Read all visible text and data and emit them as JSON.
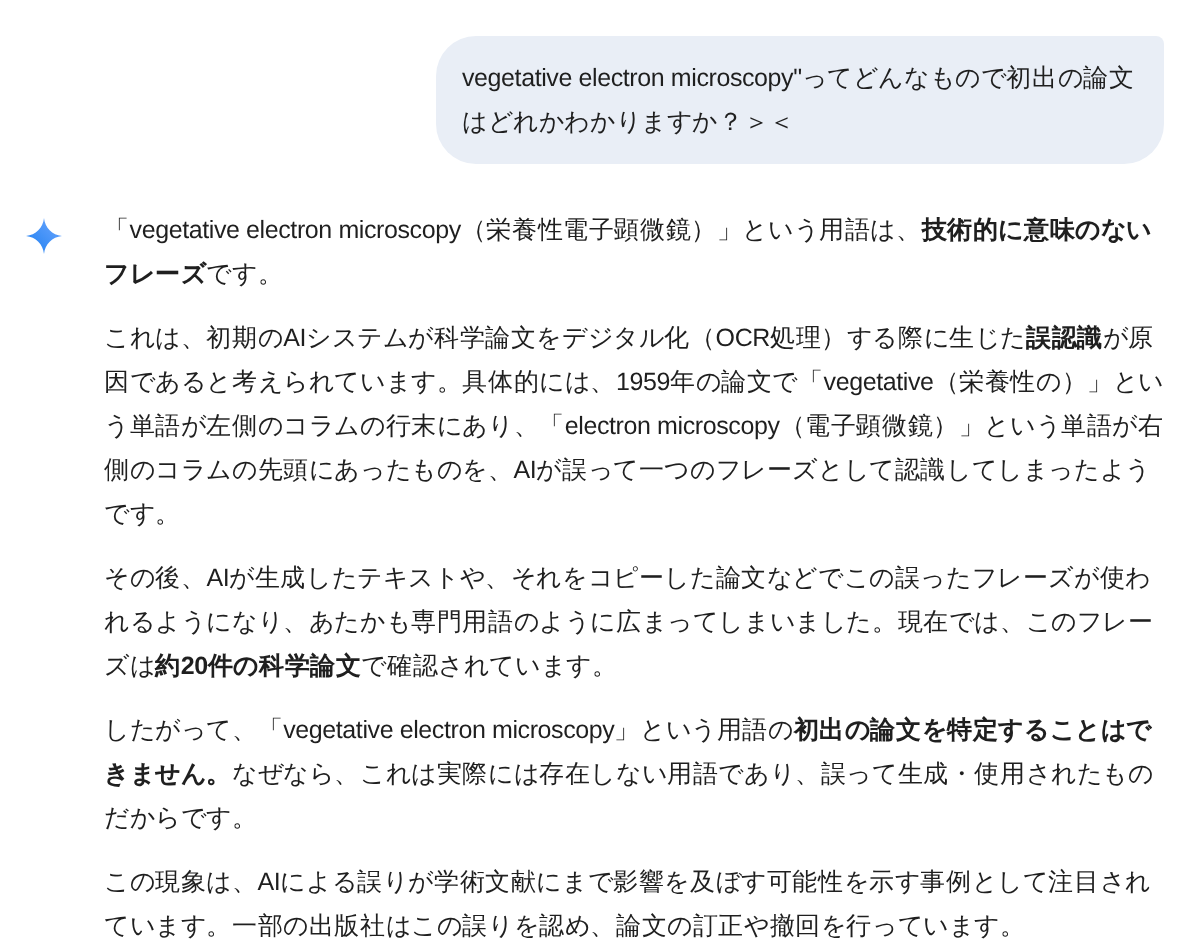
{
  "user_message": {
    "text": "vegetative electron microscopy\"ってどんなもので初出の論文はどれかわかりますか？＞＜"
  },
  "response": {
    "paragraphs": [
      "「vegetative electron microscopy（栄養性電子顕微鏡）」という用語は、**技術的に意味のないフレーズ**です。",
      "これは、初期のAIシステムが科学論文をデジタル化（OCR処理）する際に生じた**誤認識**が原因であると考えられています。具体的には、1959年の論文で「vegetative（栄養性の）」という単語が左側のコラムの行末にあり、「electron microscopy（電子顕微鏡）」という単語が右側のコラムの先頭にあったものを、AIが誤って一つのフレーズとして認識してしまったようです。",
      "その後、AIが生成したテキストや、それをコピーした論文などでこの誤ったフレーズが使われるようになり、あたかも専門用語のように広まってしまいました。現在では、このフレーズは**約20件の科学論文**で確認されています。",
      "したがって、「vegetative electron microscopy」という用語の**初出の論文を特定することはできません。**なぜなら、これは実際には存在しない用語であり、誤って生成・使用されたものだからです。",
      "この現象は、AIによる誤りが学術文献にまで影響を及ぼす可能性を示す事例として注目されています。一部の出版社はこの誤りを認め、論文の訂正や撤回を行っています。"
    ]
  }
}
